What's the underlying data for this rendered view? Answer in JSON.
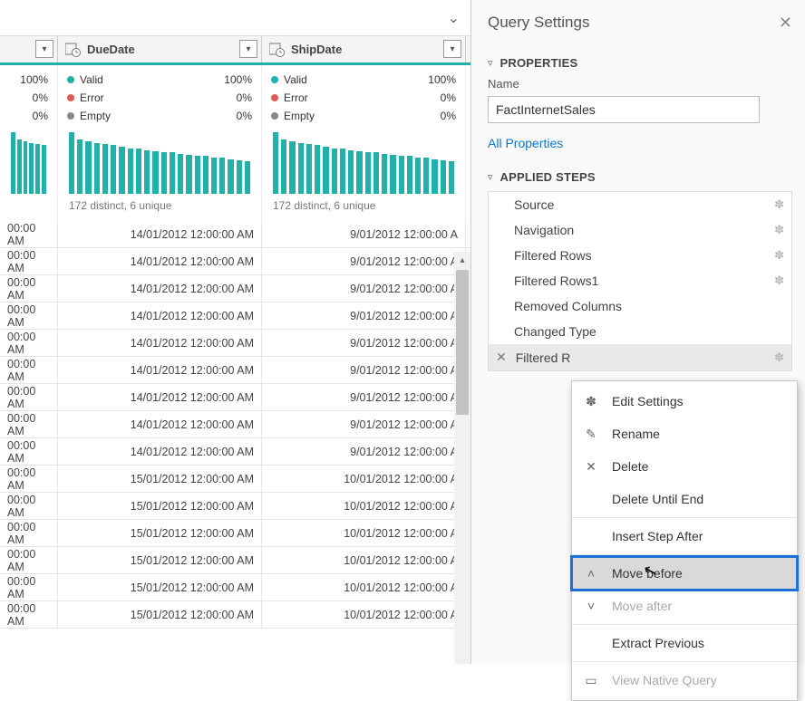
{
  "panel": {
    "title": "Query Settings",
    "properties_label": "PROPERTIES",
    "name_label": "Name",
    "name_value": "FactInternetSales",
    "all_properties": "All Properties",
    "applied_steps_label": "APPLIED STEPS",
    "steps": [
      {
        "label": "Source",
        "gear": true
      },
      {
        "label": "Navigation",
        "gear": true
      },
      {
        "label": "Filtered Rows",
        "gear": true
      },
      {
        "label": "Filtered Rows1",
        "gear": true
      },
      {
        "label": "Removed Columns",
        "gear": false
      },
      {
        "label": "Changed Type",
        "gear": false
      },
      {
        "label": "Filtered R",
        "gear": true,
        "selected": true
      }
    ]
  },
  "context_menu": {
    "items": [
      {
        "label": "Edit Settings",
        "icon": "gear"
      },
      {
        "label": "Rename",
        "icon": "rename"
      },
      {
        "label": "Delete",
        "icon": "x"
      },
      {
        "label": "Delete Until End",
        "icon": ""
      },
      {
        "sep": true
      },
      {
        "label": "Insert Step After",
        "icon": ""
      },
      {
        "sep": true
      },
      {
        "label": "Move before",
        "icon": "up",
        "highlight": true
      },
      {
        "label": "Move after",
        "icon": "down",
        "disabled": true
      },
      {
        "sep": true
      },
      {
        "label": "Extract Previous",
        "icon": ""
      },
      {
        "sep": true
      },
      {
        "label": "View Native Query",
        "icon": "doc",
        "disabled": true
      }
    ]
  },
  "table": {
    "columns": [
      {
        "name": "DueDate"
      },
      {
        "name": "ShipDate"
      }
    ],
    "quality": {
      "col0": {
        "valid": "100%",
        "error": "0%",
        "empty": "0%"
      },
      "col1": {
        "valid": "Valid",
        "valid_pct": "100%",
        "error": "Error",
        "error_pct": "0%",
        "empty": "Empty",
        "empty_pct": "0%",
        "footer": "172 distinct, 6 unique"
      },
      "col2": {
        "valid": "Valid",
        "valid_pct": "100%",
        "error": "Error",
        "error_pct": "0%",
        "empty": "Empty",
        "empty_pct": "0%",
        "footer": "172 distinct, 6 unique"
      }
    },
    "spark_heights": [
      68,
      60,
      58,
      56,
      55,
      54,
      52,
      50,
      50,
      48,
      47,
      46,
      46,
      44,
      43,
      42,
      42,
      40,
      40,
      38,
      37,
      36,
      35
    ],
    "rows": [
      {
        "c0": "00:00 AM",
        "c1": "14/01/2012 12:00:00 AM",
        "c2": "9/01/2012 12:00:00 A"
      },
      {
        "c0": "00:00 AM",
        "c1": "14/01/2012 12:00:00 AM",
        "c2": "9/01/2012 12:00:00 A"
      },
      {
        "c0": "00:00 AM",
        "c1": "14/01/2012 12:00:00 AM",
        "c2": "9/01/2012 12:00:00 A"
      },
      {
        "c0": "00:00 AM",
        "c1": "14/01/2012 12:00:00 AM",
        "c2": "9/01/2012 12:00:00 A"
      },
      {
        "c0": "00:00 AM",
        "c1": "14/01/2012 12:00:00 AM",
        "c2": "9/01/2012 12:00:00 A"
      },
      {
        "c0": "00:00 AM",
        "c1": "14/01/2012 12:00:00 AM",
        "c2": "9/01/2012 12:00:00 A"
      },
      {
        "c0": "00:00 AM",
        "c1": "14/01/2012 12:00:00 AM",
        "c2": "9/01/2012 12:00:00 A"
      },
      {
        "c0": "00:00 AM",
        "c1": "14/01/2012 12:00:00 AM",
        "c2": "9/01/2012 12:00:00 A"
      },
      {
        "c0": "00:00 AM",
        "c1": "14/01/2012 12:00:00 AM",
        "c2": "9/01/2012 12:00:00 A"
      },
      {
        "c0": "00:00 AM",
        "c1": "15/01/2012 12:00:00 AM",
        "c2": "10/01/2012 12:00:00 A"
      },
      {
        "c0": "00:00 AM",
        "c1": "15/01/2012 12:00:00 AM",
        "c2": "10/01/2012 12:00:00 A"
      },
      {
        "c0": "00:00 AM",
        "c1": "15/01/2012 12:00:00 AM",
        "c2": "10/01/2012 12:00:00 A"
      },
      {
        "c0": "00:00 AM",
        "c1": "15/01/2012 12:00:00 AM",
        "c2": "10/01/2012 12:00:00 A"
      },
      {
        "c0": "00:00 AM",
        "c1": "15/01/2012 12:00:00 AM",
        "c2": "10/01/2012 12:00:00 A"
      },
      {
        "c0": "00:00 AM",
        "c1": "15/01/2012 12:00:00 AM",
        "c2": "10/01/2012 12:00:00 A"
      }
    ]
  }
}
